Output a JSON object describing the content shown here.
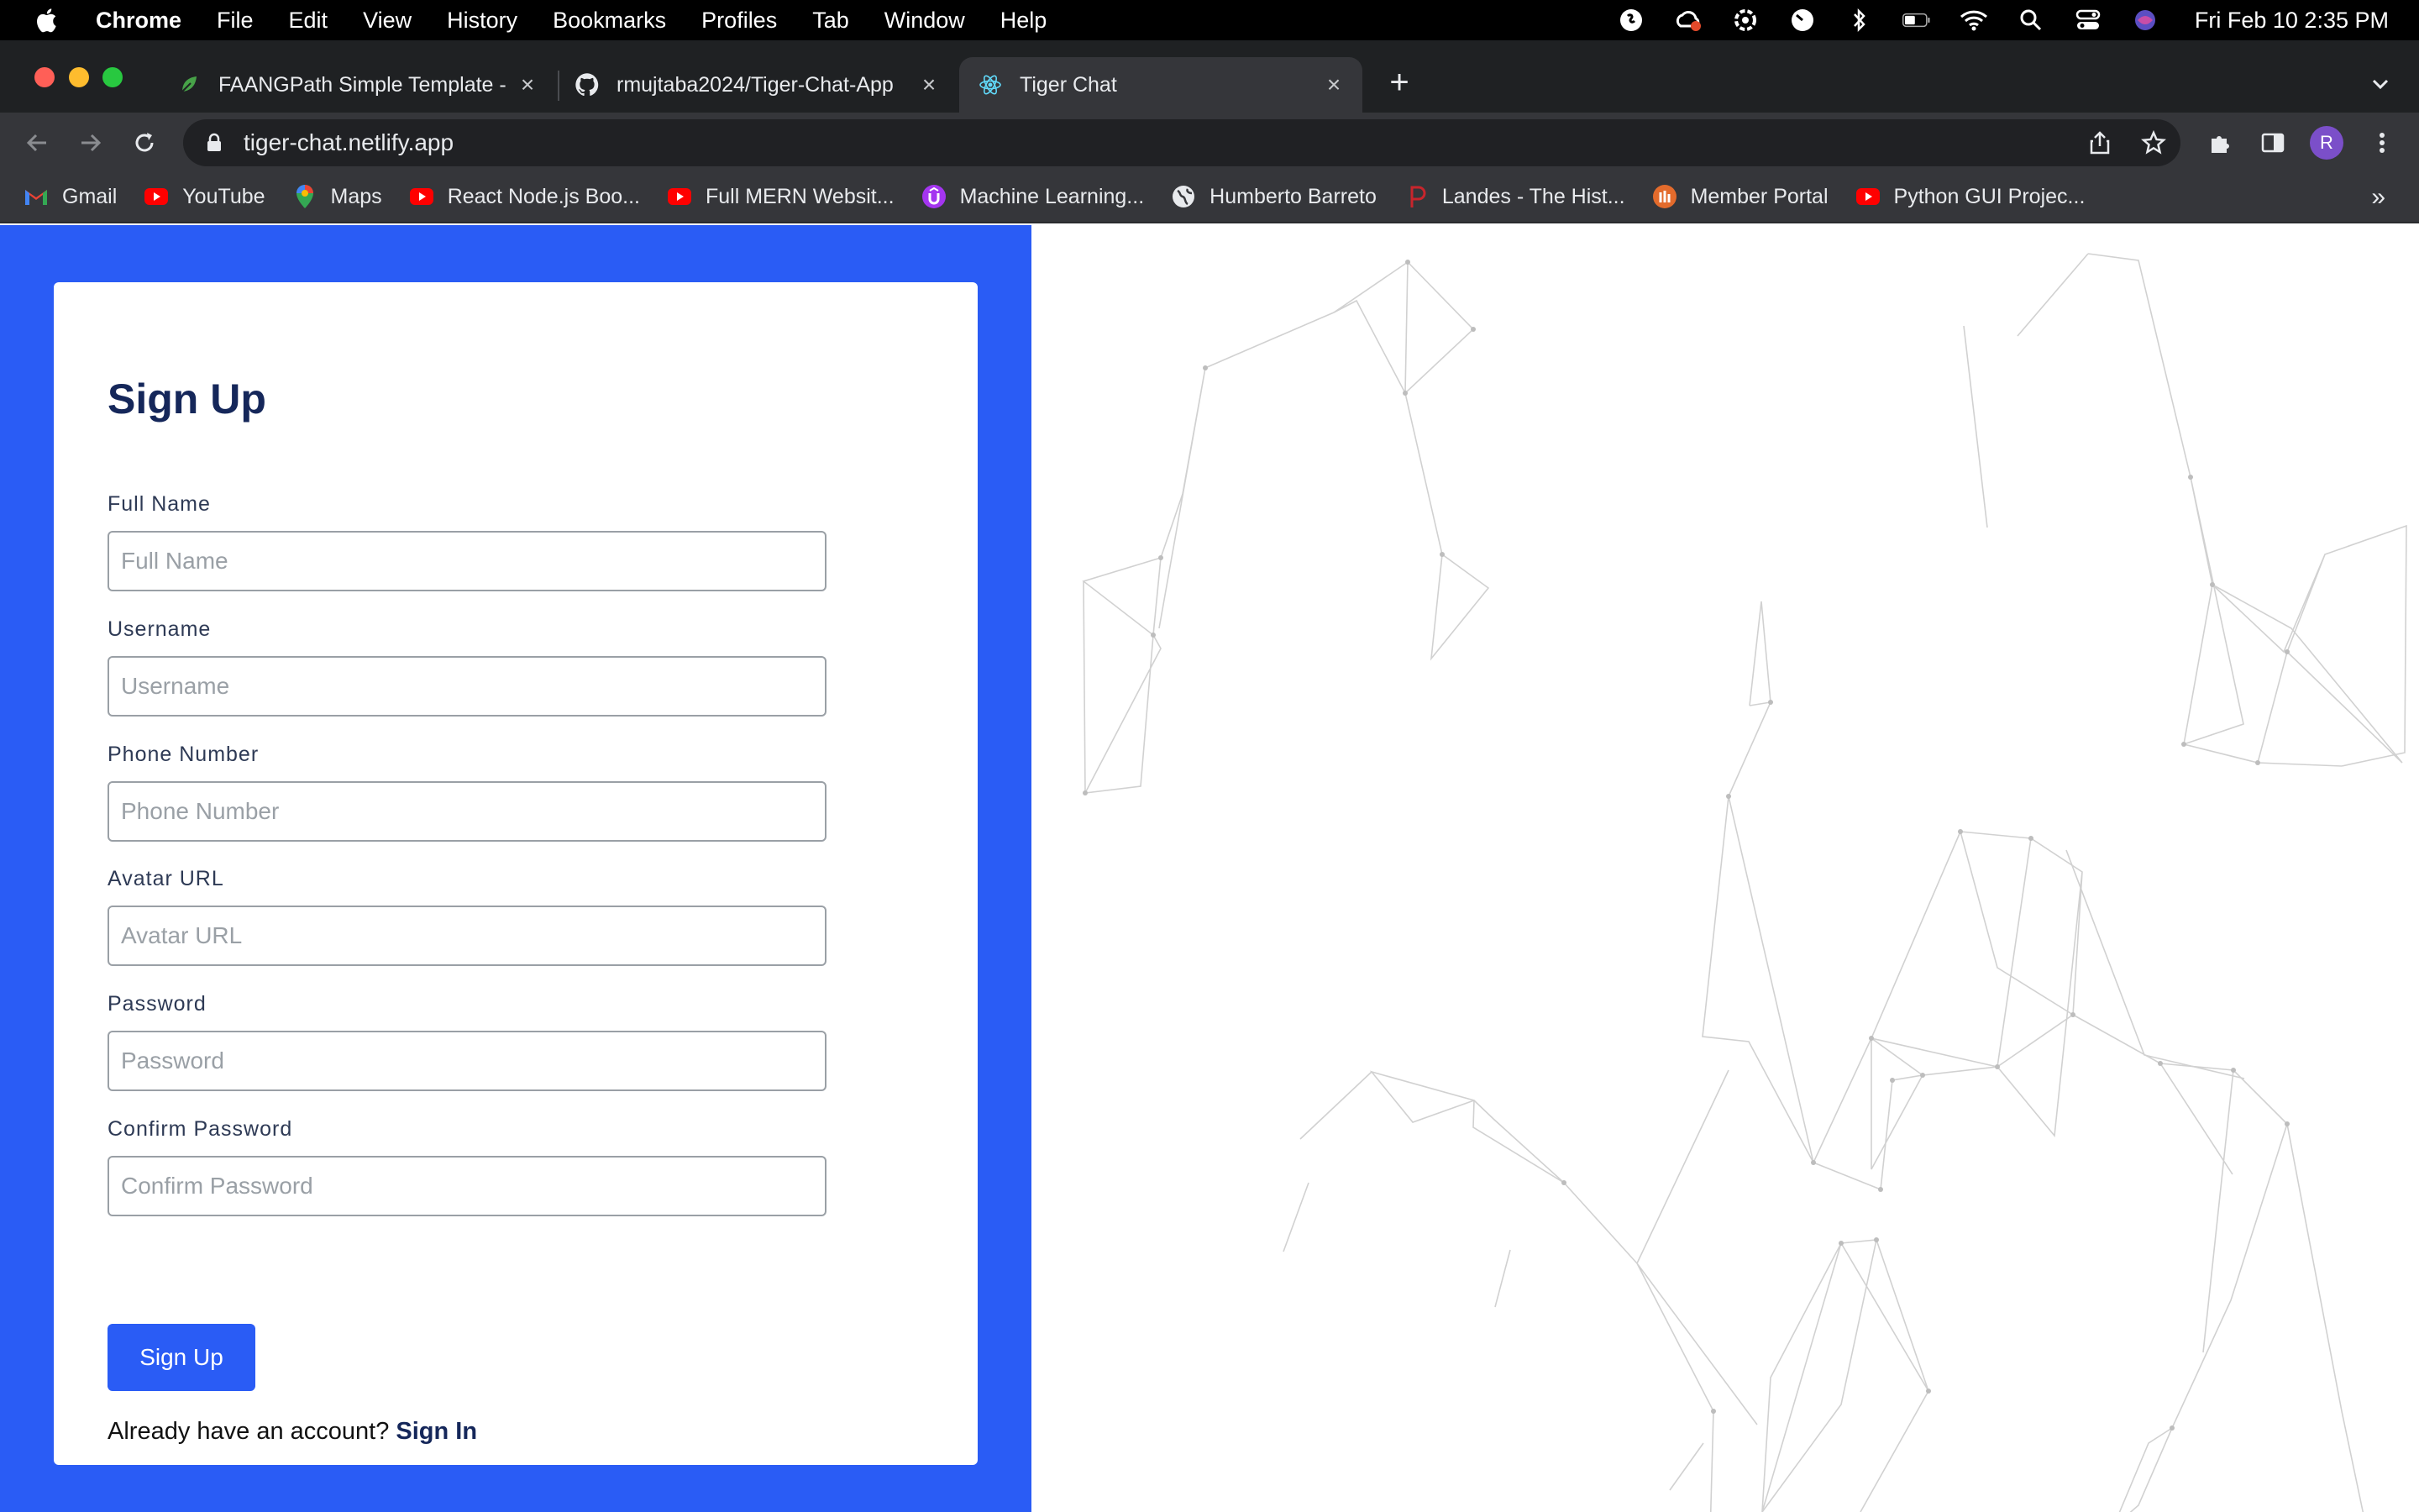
{
  "menubar": {
    "app_name": "Chrome",
    "items": [
      "File",
      "Edit",
      "View",
      "History",
      "Bookmarks",
      "Profiles",
      "Tab",
      "Window",
      "Help"
    ],
    "clock": "Fri Feb 10  2:35 PM"
  },
  "tabs": [
    {
      "title": "FAANGPath Simple Template -",
      "icon": "leaf-icon"
    },
    {
      "title": "rmujtaba2024/Tiger-Chat-App",
      "icon": "github-icon"
    },
    {
      "title": "Tiger Chat",
      "icon": "react-icon",
      "active": true
    }
  ],
  "address_bar": {
    "url": "tiger-chat.netlify.app"
  },
  "profile_initial": "R",
  "bookmarks": [
    {
      "label": "Gmail",
      "icon": "gmail-icon"
    },
    {
      "label": "YouTube",
      "icon": "youtube-icon"
    },
    {
      "label": "Maps",
      "icon": "maps-icon"
    },
    {
      "label": "React Node.js Boo...",
      "icon": "youtube-icon"
    },
    {
      "label": "Full MERN Websit...",
      "icon": "youtube-icon"
    },
    {
      "label": "Machine Learning...",
      "icon": "udemy-icon"
    },
    {
      "label": "Humberto Barreto",
      "icon": "globe-icon"
    },
    {
      "label": "Landes - The Hist...",
      "icon": "p-icon"
    },
    {
      "label": "Member Portal",
      "icon": "portal-icon"
    },
    {
      "label": "Python GUI Projec...",
      "icon": "youtube-icon"
    }
  ],
  "bookmarks_more": "»",
  "form": {
    "title": "Sign Up",
    "fields": [
      {
        "label": "Full Name",
        "placeholder": "Full Name"
      },
      {
        "label": "Username",
        "placeholder": "Username"
      },
      {
        "label": "Phone Number",
        "placeholder": "Phone Number"
      },
      {
        "label": "Avatar URL",
        "placeholder": "Avatar URL"
      },
      {
        "label": "Password",
        "placeholder": "Password"
      },
      {
        "label": "Confirm Password",
        "placeholder": "Confirm Password"
      }
    ],
    "submit_label": "Sign Up",
    "signin_prompt": "Already have an account?",
    "signin_link": "Sign In"
  },
  "colors": {
    "brand_blue": "#2a5cf5",
    "heading_navy": "#15275a"
  }
}
